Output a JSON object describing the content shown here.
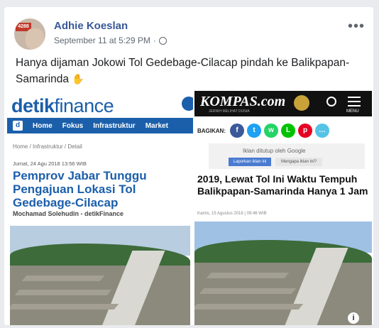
{
  "post": {
    "author": "Adhie Koeslan",
    "timestamp": "September 11 at 5:29 PM",
    "privacy_sep": "·",
    "text": "Hanya dijaman Jokowi Tol Gedebage-Cilacap pindah ke Balikpapan-Samarinda",
    "emoji_icon": "waving-hand-icon",
    "more_label": "•••",
    "avatar_tag": "4288"
  },
  "left_article": {
    "logo_main": "detik",
    "logo_sub": "finance",
    "nav": [
      "Home",
      "Fokus",
      "Infrastruktur",
      "Market"
    ],
    "nav_icon": "d",
    "breadcrumb": "Home / Infrastruktur / Detail",
    "date": "Jumat, 24 Agu 2018 13:56 WIB",
    "headline": "Pemprov Jabar Tunggu Pengajuan Lokasi Tol Gedebage-Cilacap",
    "author": "Mochamad Solehudin - detikFinance"
  },
  "right_article": {
    "logo": "KOMPAS.com",
    "logo_sub": "JERNIH MELIHAT DUNIA",
    "menu_label": "MENU",
    "share_label": "BAGIKAN:",
    "share_icons": [
      {
        "name": "facebook-icon",
        "glyph": "f",
        "color": "#3b5998"
      },
      {
        "name": "twitter-icon",
        "glyph": "t",
        "color": "#1da1f2"
      },
      {
        "name": "whatsapp-icon",
        "glyph": "w",
        "color": "#25d366"
      },
      {
        "name": "line-icon",
        "glyph": "L",
        "color": "#00c300"
      },
      {
        "name": "pinterest-icon",
        "glyph": "p",
        "color": "#e60023"
      },
      {
        "name": "comment-icon",
        "glyph": "…",
        "color": "#55c3e6"
      }
    ],
    "ad_text": "Iklan ditutup oleh Google",
    "ad_report": "Laporkan iklan ini",
    "ad_why": "Mengapa iklan ini?",
    "headline": "2019, Lewat Tol Ini Waktu Tempuh Balikpapan-Samarinda Hanya 1 Jam",
    "date": "Kamis, 15 Agustus 2018 | 09:46 WIB",
    "info_glyph": "i"
  }
}
